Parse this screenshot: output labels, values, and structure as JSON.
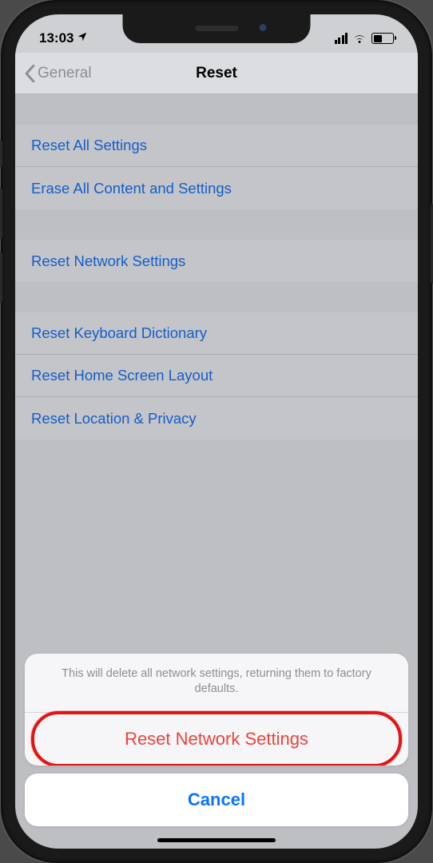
{
  "status": {
    "time": "13:03"
  },
  "nav": {
    "back": "General",
    "title": "Reset"
  },
  "groups": [
    {
      "items": [
        {
          "label": "Reset All Settings"
        },
        {
          "label": "Erase All Content and Settings"
        }
      ]
    },
    {
      "items": [
        {
          "label": "Reset Network Settings"
        }
      ]
    },
    {
      "items": [
        {
          "label": "Reset Keyboard Dictionary"
        },
        {
          "label": "Reset Home Screen Layout"
        },
        {
          "label": "Reset Location & Privacy"
        }
      ]
    }
  ],
  "sheet": {
    "message": "This will delete all network settings, returning them to factory defaults.",
    "destructive": "Reset Network Settings",
    "cancel": "Cancel"
  }
}
